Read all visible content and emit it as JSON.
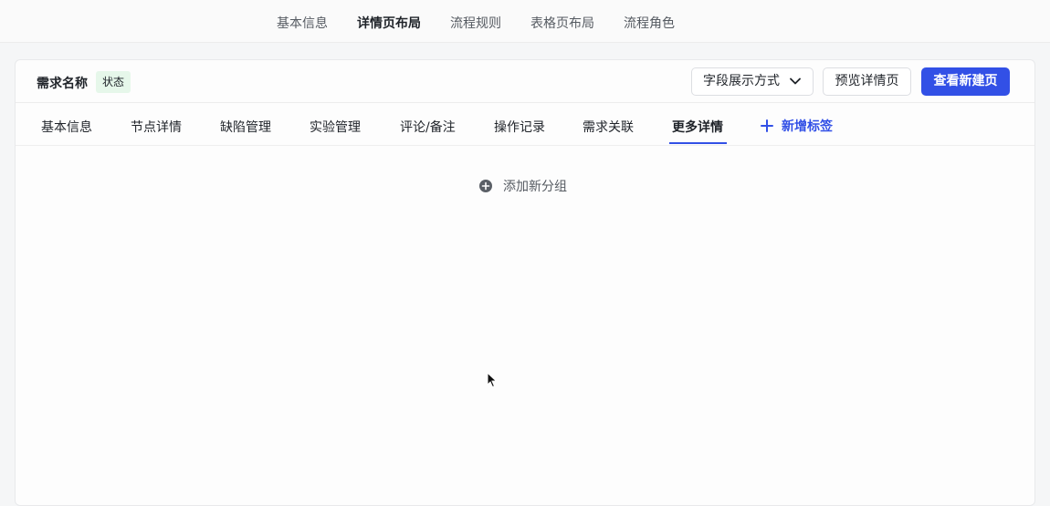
{
  "top_nav": {
    "tabs": [
      {
        "label": "基本信息"
      },
      {
        "label": "详情页布局"
      },
      {
        "label": "流程规则"
      },
      {
        "label": "表格页布局"
      },
      {
        "label": "流程角色"
      }
    ],
    "active": "详情页布局"
  },
  "header": {
    "title": "需求名称",
    "status": "状态",
    "field_display_label": "字段展示方式",
    "preview_label": "预览详情页",
    "new_page_label": "查看新建页"
  },
  "detail_tabs": {
    "items": [
      {
        "label": "基本信息"
      },
      {
        "label": "节点详情"
      },
      {
        "label": "缺陷管理"
      },
      {
        "label": "实验管理"
      },
      {
        "label": "评论/备注"
      },
      {
        "label": "操作记录"
      },
      {
        "label": "需求关联"
      },
      {
        "label": "更多详情"
      }
    ],
    "active": "更多详情",
    "add_label": "新增标签"
  },
  "content": {
    "add_group_label": "添加新分组"
  },
  "colors": {
    "accent": "#3250e6",
    "status_bg": "#e6f7ea"
  },
  "icons": [
    "chevron-down-icon",
    "plus-icon",
    "plus-circle-icon",
    "mouse-cursor-icon"
  ]
}
